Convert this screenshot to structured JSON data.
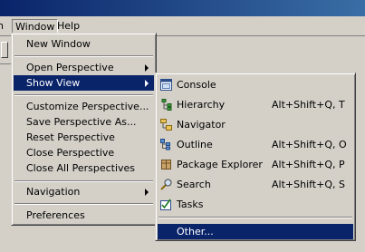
{
  "menubar": {
    "cut_item": "n",
    "window_label": "Window",
    "help_label": "Help"
  },
  "window_menu": {
    "items": [
      {
        "label": "New Window"
      },
      {
        "label": "Open Perspective"
      },
      {
        "label": "Show View"
      },
      {
        "label": "Customize Perspective..."
      },
      {
        "label": "Save Perspective As..."
      },
      {
        "label": "Reset Perspective"
      },
      {
        "label": "Close Perspective"
      },
      {
        "label": "Close All Perspectives"
      },
      {
        "label": "Navigation"
      },
      {
        "label": "Preferences"
      }
    ]
  },
  "show_view_menu": {
    "items": [
      {
        "label": "Console",
        "shortcut": "",
        "icon": "console-icon"
      },
      {
        "label": "Hierarchy",
        "shortcut": "Alt+Shift+Q, T",
        "icon": "hierarchy-icon"
      },
      {
        "label": "Navigator",
        "shortcut": "",
        "icon": "navigator-icon"
      },
      {
        "label": "Outline",
        "shortcut": "Alt+Shift+Q, O",
        "icon": "outline-icon"
      },
      {
        "label": "Package Explorer",
        "shortcut": "Alt+Shift+Q, P",
        "icon": "package-explorer-icon"
      },
      {
        "label": "Search",
        "shortcut": "Alt+Shift+Q, S",
        "icon": "search-icon"
      },
      {
        "label": "Tasks",
        "shortcut": "",
        "icon": "tasks-icon"
      },
      {
        "label": "Other...",
        "shortcut": "",
        "icon": ""
      }
    ]
  },
  "colors": {
    "menu_bg": "#d4d0c8",
    "selection": "#0a246a",
    "title_gradient_start": "#0a246a",
    "title_gradient_end": "#3a6ea5"
  }
}
